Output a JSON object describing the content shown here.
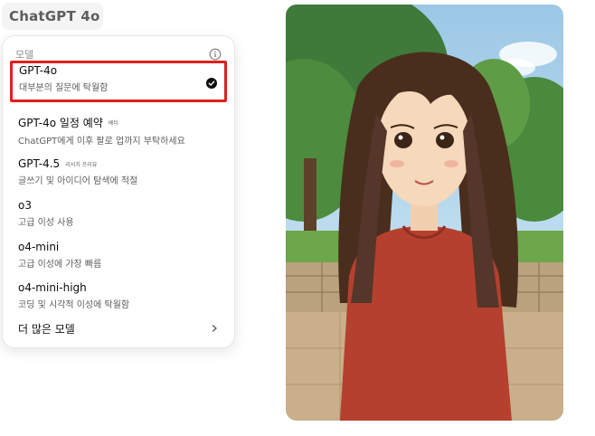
{
  "header": {
    "model_name": "ChatGPT 4o"
  },
  "menu": {
    "section_label": "모델",
    "items": [
      {
        "name": "GPT-4o",
        "tag": "",
        "desc": "대부분의 질문에 탁월함",
        "selected": true
      },
      {
        "name": "GPT-4o 일정 예약",
        "tag": "베타",
        "desc": "ChatGPT에게 이후 팔로 업까지 부탁하세요"
      },
      {
        "name": "GPT-4.5",
        "tag": "리서치 프리뷰",
        "desc": "글쓰기 및 아이디어 탐색에 적절"
      },
      {
        "name": "o3",
        "tag": "",
        "desc": "고급 이성 사용"
      },
      {
        "name": "o4-mini",
        "tag": "",
        "desc": "고급 이성에 가장 빠름"
      },
      {
        "name": "o4-mini-high",
        "tag": "",
        "desc": "코딩 및 시각적 이성에 탁월함"
      }
    ],
    "more_label": "더 많은 모델"
  },
  "icons": {
    "switcher": "chevron-down-icon",
    "info": "info-icon",
    "selected": "check-circle-icon",
    "more": "chevron-right-icon"
  },
  "colors": {
    "highlight": "#e0201f",
    "text": "#0d0d0d",
    "muted": "#5d5d5d"
  }
}
